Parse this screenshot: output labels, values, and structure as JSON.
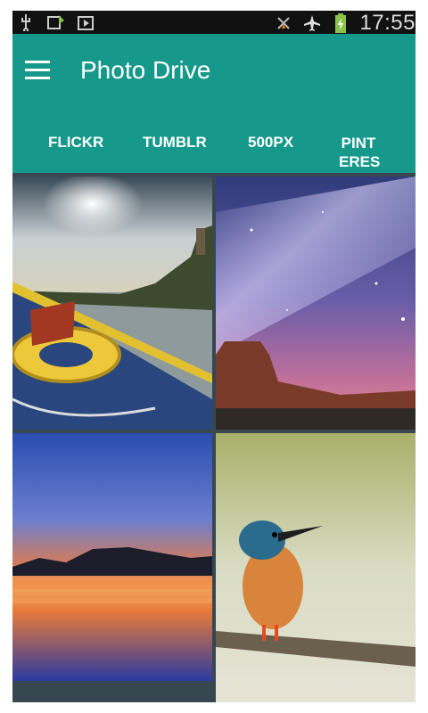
{
  "status_bar": {
    "time": "17:55",
    "icons": [
      "usb-icon",
      "sync-icon",
      "play-store-icon",
      "signal-icon",
      "airplane-mode-icon",
      "battery-charging-icon"
    ]
  },
  "app_bar": {
    "title": "Photo Drive",
    "menu_icon": "hamburger-menu-icon"
  },
  "tabs": [
    {
      "label": "FLICKR"
    },
    {
      "label": "TUMBLR"
    },
    {
      "label": "500PX"
    },
    {
      "label": "PINT\nERES"
    }
  ],
  "photos": [
    {
      "subject": "boat-on-river-sunset"
    },
    {
      "subject": "milky-way-over-mesa"
    },
    {
      "subject": "lake-sunset-reflection"
    },
    {
      "subject": "kingfisher-on-branch"
    }
  ],
  "colors": {
    "primary": "#16998a",
    "status_bar": "#111111",
    "grid_background": "#37474f"
  }
}
